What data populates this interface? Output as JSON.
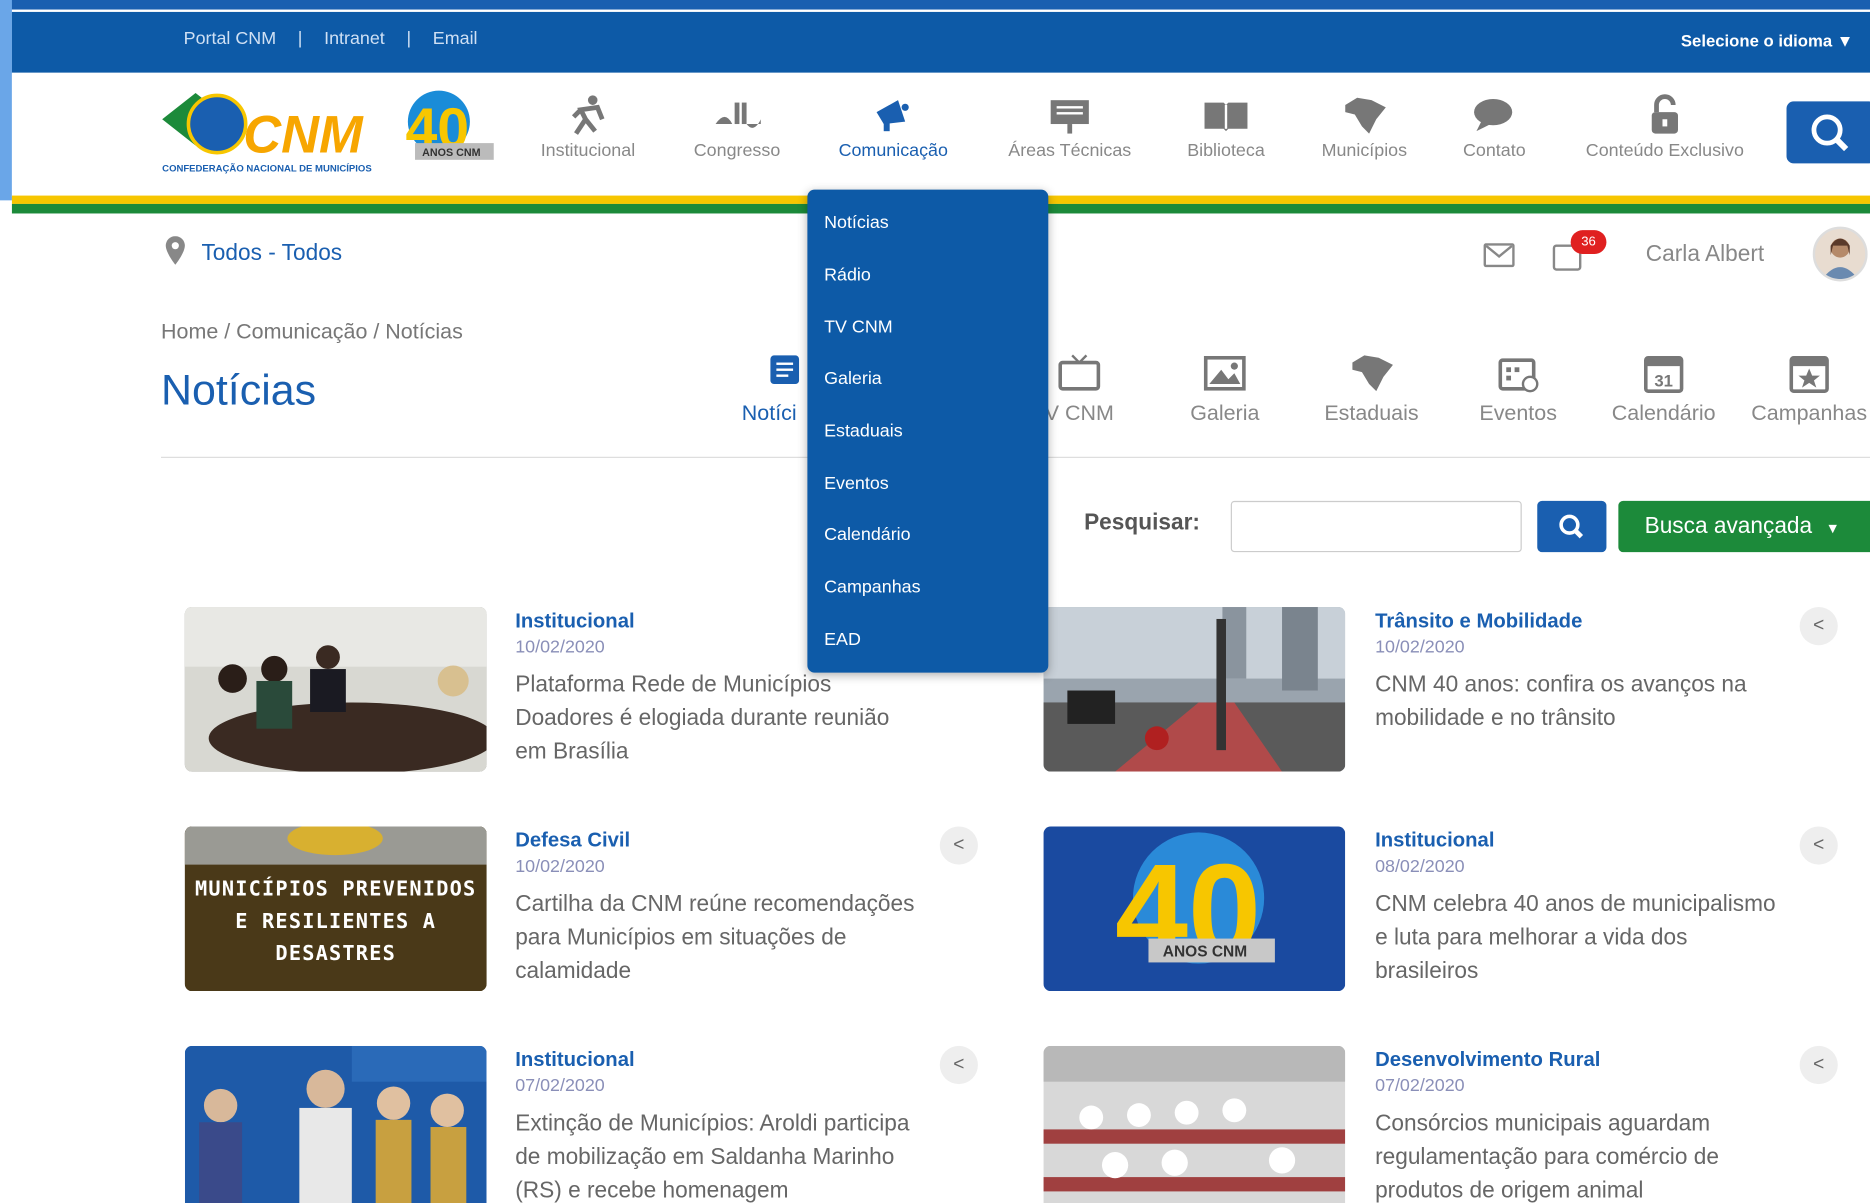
{
  "topbar": {
    "links": [
      "Portal CNM",
      "|",
      "Intranet",
      "|",
      "Email"
    ],
    "language": "Selecione o idioma ▼"
  },
  "logo": {
    "text": "CNM",
    "tagline": "CONFEDERAÇÃO NACIONAL DE MUNICÍPIOS",
    "anniversary": "40",
    "anniversary_label": "ANOS CNM"
  },
  "nav": [
    {
      "label": "Institucional",
      "icon": "running-person-icon"
    },
    {
      "label": "Congresso",
      "icon": "congress-icon"
    },
    {
      "label": "Comunicação",
      "icon": "megaphone-icon",
      "active": true
    },
    {
      "label": "Áreas Técnicas",
      "icon": "presentation-icon"
    },
    {
      "label": "Biblioteca",
      "icon": "book-icon"
    },
    {
      "label": "Municípios",
      "icon": "brazil-map-icon"
    },
    {
      "label": "Contato",
      "icon": "chat-icon"
    },
    {
      "label": "Conteúdo Exclusivo",
      "icon": "lock-icon"
    }
  ],
  "location": "Todos - Todos",
  "user": {
    "name": "Carla Albert",
    "notifications": "36"
  },
  "breadcrumb": "Home / Comunicação / Notícias",
  "page_title": "Notícias",
  "subnav": [
    "Notíci",
    "V CNM",
    "Galeria",
    "Estaduais",
    "Eventos",
    "Calendário",
    "Campanhas"
  ],
  "calendar_day": "31",
  "search": {
    "label": "Pesquisar:",
    "value": "",
    "advanced": "Busca avançada"
  },
  "dropdown": [
    "Notícias",
    "Rádio",
    "TV CNM",
    "Galeria",
    "Estaduais",
    "Eventos",
    "Calendário",
    "Campanhas",
    "EAD"
  ],
  "news": [
    {
      "category": "Institucional",
      "date": "10/02/2020",
      "title": [
        "Plataforma Rede de Municípios",
        "Doadores é elogiada durante reunião",
        "em Brasília"
      ]
    },
    {
      "category": "Trânsito e Mobilidade",
      "date": "10/02/2020",
      "title": [
        "CNM 40 anos: confira os avanços na",
        "mobilidade e no trânsito"
      ]
    },
    {
      "category": "Defesa Civil",
      "date": "10/02/2020",
      "title": [
        "Cartilha da CNM reúne recomendações",
        "para Municípios em situações de",
        "calamidade"
      ],
      "image_text": [
        "MUNICÍPIOS PREVENIDOS",
        "E RESILIENTES A",
        "DESASTRES"
      ]
    },
    {
      "category": "Institucional",
      "date": "08/02/2020",
      "title": [
        "CNM celebra 40 anos de municipalismo",
        "e luta para melhorar a vida dos",
        "brasileiros"
      ]
    },
    {
      "category": "Institucional",
      "date": "07/02/2020",
      "title": [
        "Extinção de Municípios: Aroldi participa",
        "de mobilização em Saldanha Marinho",
        "(RS) e recebe homenagem"
      ]
    },
    {
      "category": "Desenvolvimento Rural",
      "date": "07/02/2020",
      "title": [
        "Consórcios municipais aguardam",
        "regulamentação para comércio de",
        "produtos de origem animal"
      ]
    }
  ],
  "colors": {
    "brand_blue": "#1a5fb0",
    "topbar_blue": "#0d5aa7",
    "green": "#1c8a3a",
    "yellow": "#f7c600"
  }
}
